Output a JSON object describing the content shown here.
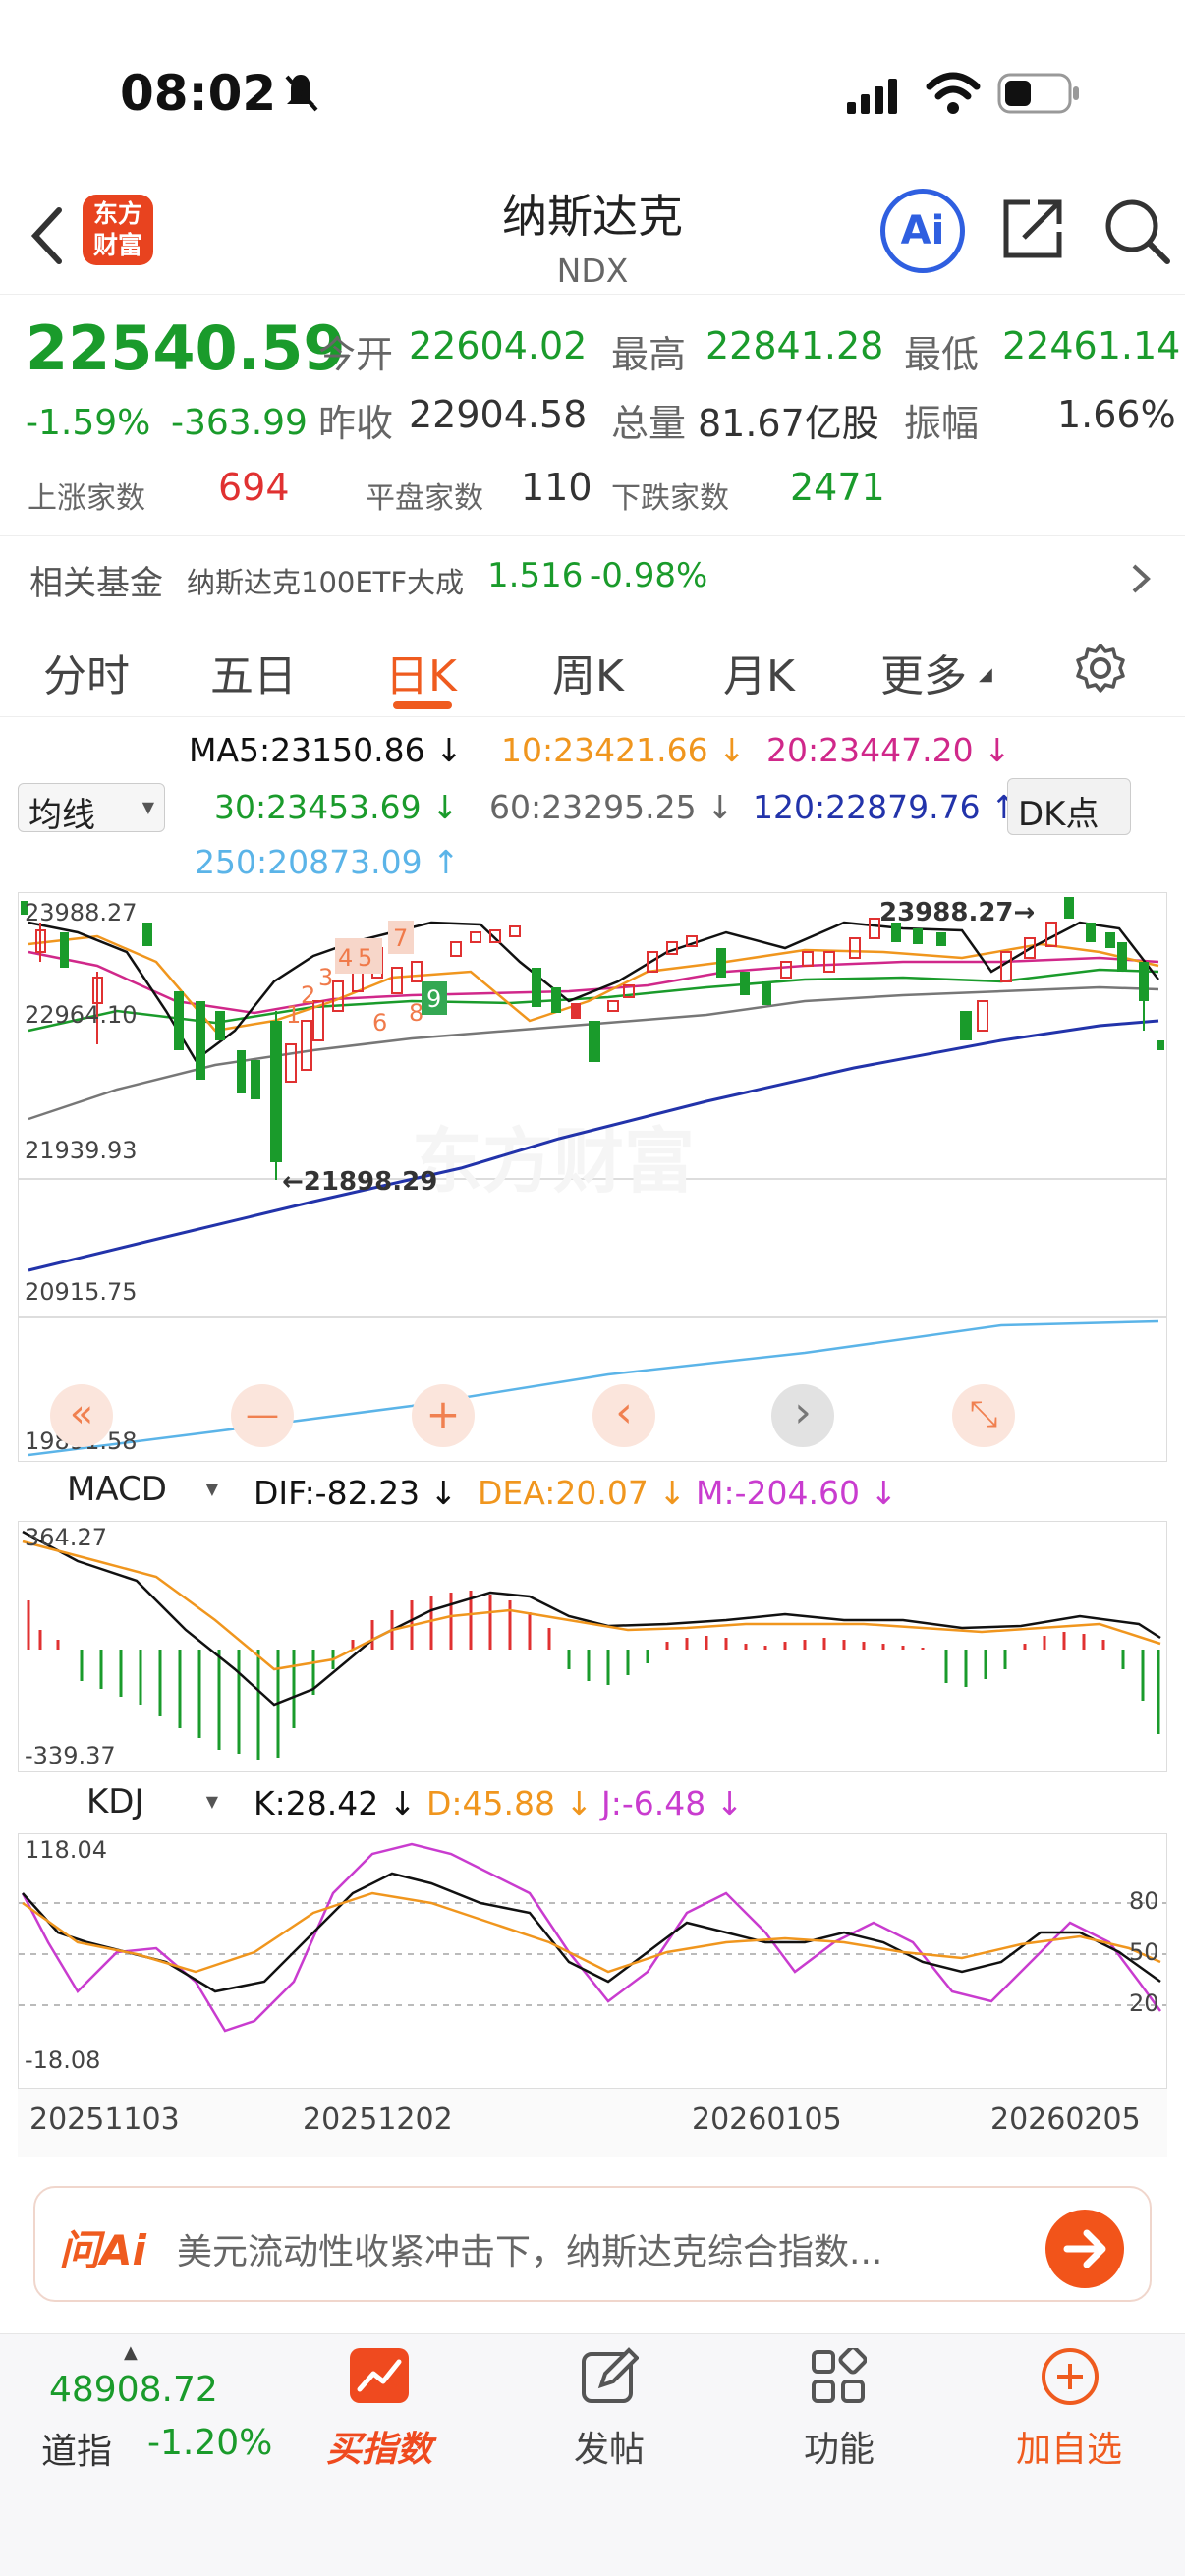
{
  "status_bar": {
    "time": "08:02"
  },
  "header": {
    "title": "纳斯达克",
    "code": "NDX",
    "logo_text_1": "东方",
    "logo_text_2": "财富",
    "ai_label": "Ai"
  },
  "quote": {
    "price": "22540.59",
    "change_pct": "-1.59%",
    "change": "-363.99",
    "open_label": "今开",
    "open": "22604.02",
    "high_label": "最高",
    "high": "22841.28",
    "low_label": "最低",
    "low": "22461.14",
    "prev_label": "昨收",
    "prev": "22904.58",
    "vol_label": "总量",
    "vol": "81.67亿股",
    "amp_label": "振幅",
    "amp": "1.66%",
    "up_label": "上涨家数",
    "up": "694",
    "flat_label": "平盘家数",
    "flat": "110",
    "down_label": "下跌家数",
    "down": "2471"
  },
  "fund": {
    "label": "相关基金",
    "name": "纳斯达克100ETF大成",
    "price": "1.516",
    "change": "-0.98%"
  },
  "tabs": [
    "分时",
    "五日",
    "日K",
    "周K",
    "月K",
    "更多"
  ],
  "ma": {
    "selector": "均线",
    "ma5": "MA5:23150.86 ↓",
    "ma10": "10:23421.66 ↓",
    "ma20": "20:23447.20 ↓",
    "ma30": "30:23453.69 ↓",
    "ma60": "60:23295.25 ↓",
    "ma120": "120:22879.76 ↑",
    "ma250": "250:20873.09 ↑",
    "dk": "DK点"
  },
  "kline": {
    "y_labels": [
      "23988.27",
      "22964.10",
      "21939.93",
      "20915.75",
      "19891.58"
    ],
    "high_marker": "23988.27→",
    "low_marker": "←21898.29",
    "watermark": "东方财富",
    "nums": [
      "1",
      "2",
      "3",
      "4",
      "5",
      "6",
      "7",
      "8",
      "9"
    ],
    "ctrl": [
      "«",
      "—",
      "+",
      "‹",
      "›",
      "⤡"
    ]
  },
  "macd": {
    "selector": "MACD",
    "dif": "DIF:-82.23 ↓",
    "dea": "DEA:20.07 ↓",
    "m": "M:-204.60 ↓",
    "top": "364.27",
    "bottom": "-339.37"
  },
  "kdj": {
    "selector": "KDJ",
    "k": "K:28.42 ↓",
    "d": "D:45.88 ↓",
    "j": "J:-6.48 ↓",
    "top": "118.04",
    "bottom": "-18.08",
    "levels": [
      "80",
      "50",
      "20"
    ]
  },
  "dates": [
    "20251103",
    "20251202",
    "20260105",
    "20260205"
  ],
  "ai": {
    "brand": "问Ai",
    "text": "美元流动性收紧冲击下，纳斯达克综合指数..."
  },
  "bottom": {
    "index_value": "48908.72",
    "index_name": "道指",
    "index_change": "-1.20%",
    "buy": "买指数",
    "post": "发帖",
    "func": "功能",
    "add": "加自选"
  }
}
